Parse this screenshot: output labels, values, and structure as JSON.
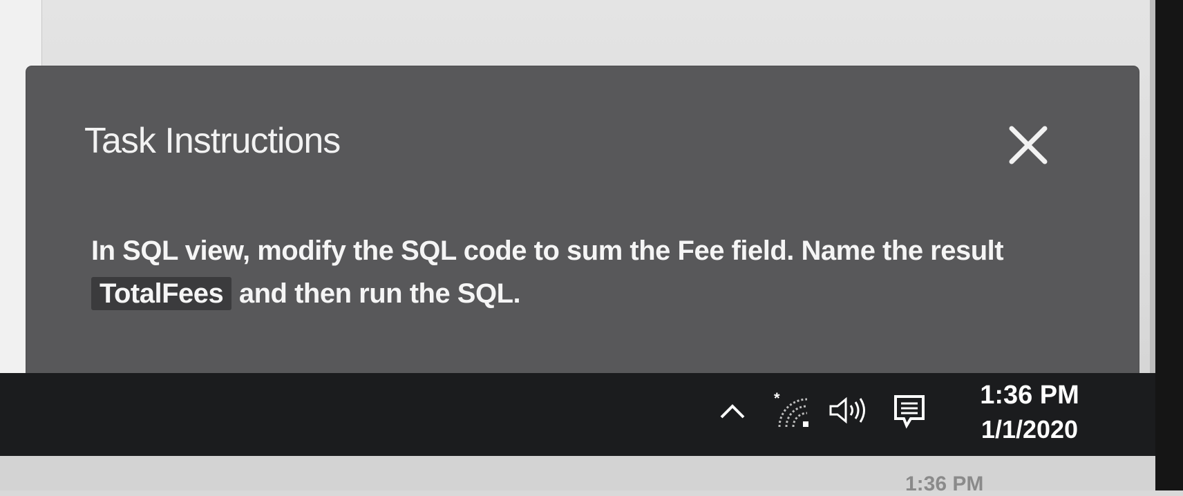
{
  "panel": {
    "title": "Task Instructions",
    "close_icon": "close-icon",
    "body_part1": "In SQL view, modify the SQL code to sum the Fee field. Name the result",
    "body_code": "TotalFees",
    "body_part2": "and then run the SQL."
  },
  "taskbar": {
    "tray_icons": [
      "chevron-up-icon",
      "wifi-icon",
      "volume-icon",
      "action-center-icon"
    ],
    "clock_time": "1:36 PM",
    "clock_date": "1/1/2020"
  },
  "background": {
    "clock_fragment": "1:36 PM"
  },
  "colors": {
    "panel_bg": "#58585a",
    "taskbar_bg": "#1b1c1e",
    "text": "#f5f5f5"
  }
}
